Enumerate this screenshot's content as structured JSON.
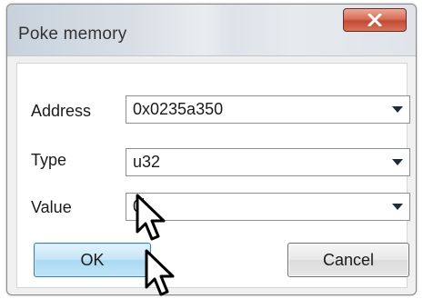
{
  "dialog": {
    "title": "Poke memory",
    "close_icon": "close-icon"
  },
  "fields": {
    "address": {
      "label": "Address",
      "value": "0x0235a350"
    },
    "type": {
      "label": "Type",
      "value": "u32"
    },
    "value": {
      "label": "Value",
      "value": "0"
    }
  },
  "buttons": {
    "ok_label": "OK",
    "cancel_label": "Cancel"
  },
  "colors": {
    "ok_accent": "#3c7fb1",
    "close_button": "#c24b35",
    "window_bg": "#f0f0f0"
  },
  "cursors": [
    "pointer-cursor-icon",
    "pointer-cursor-icon"
  ]
}
